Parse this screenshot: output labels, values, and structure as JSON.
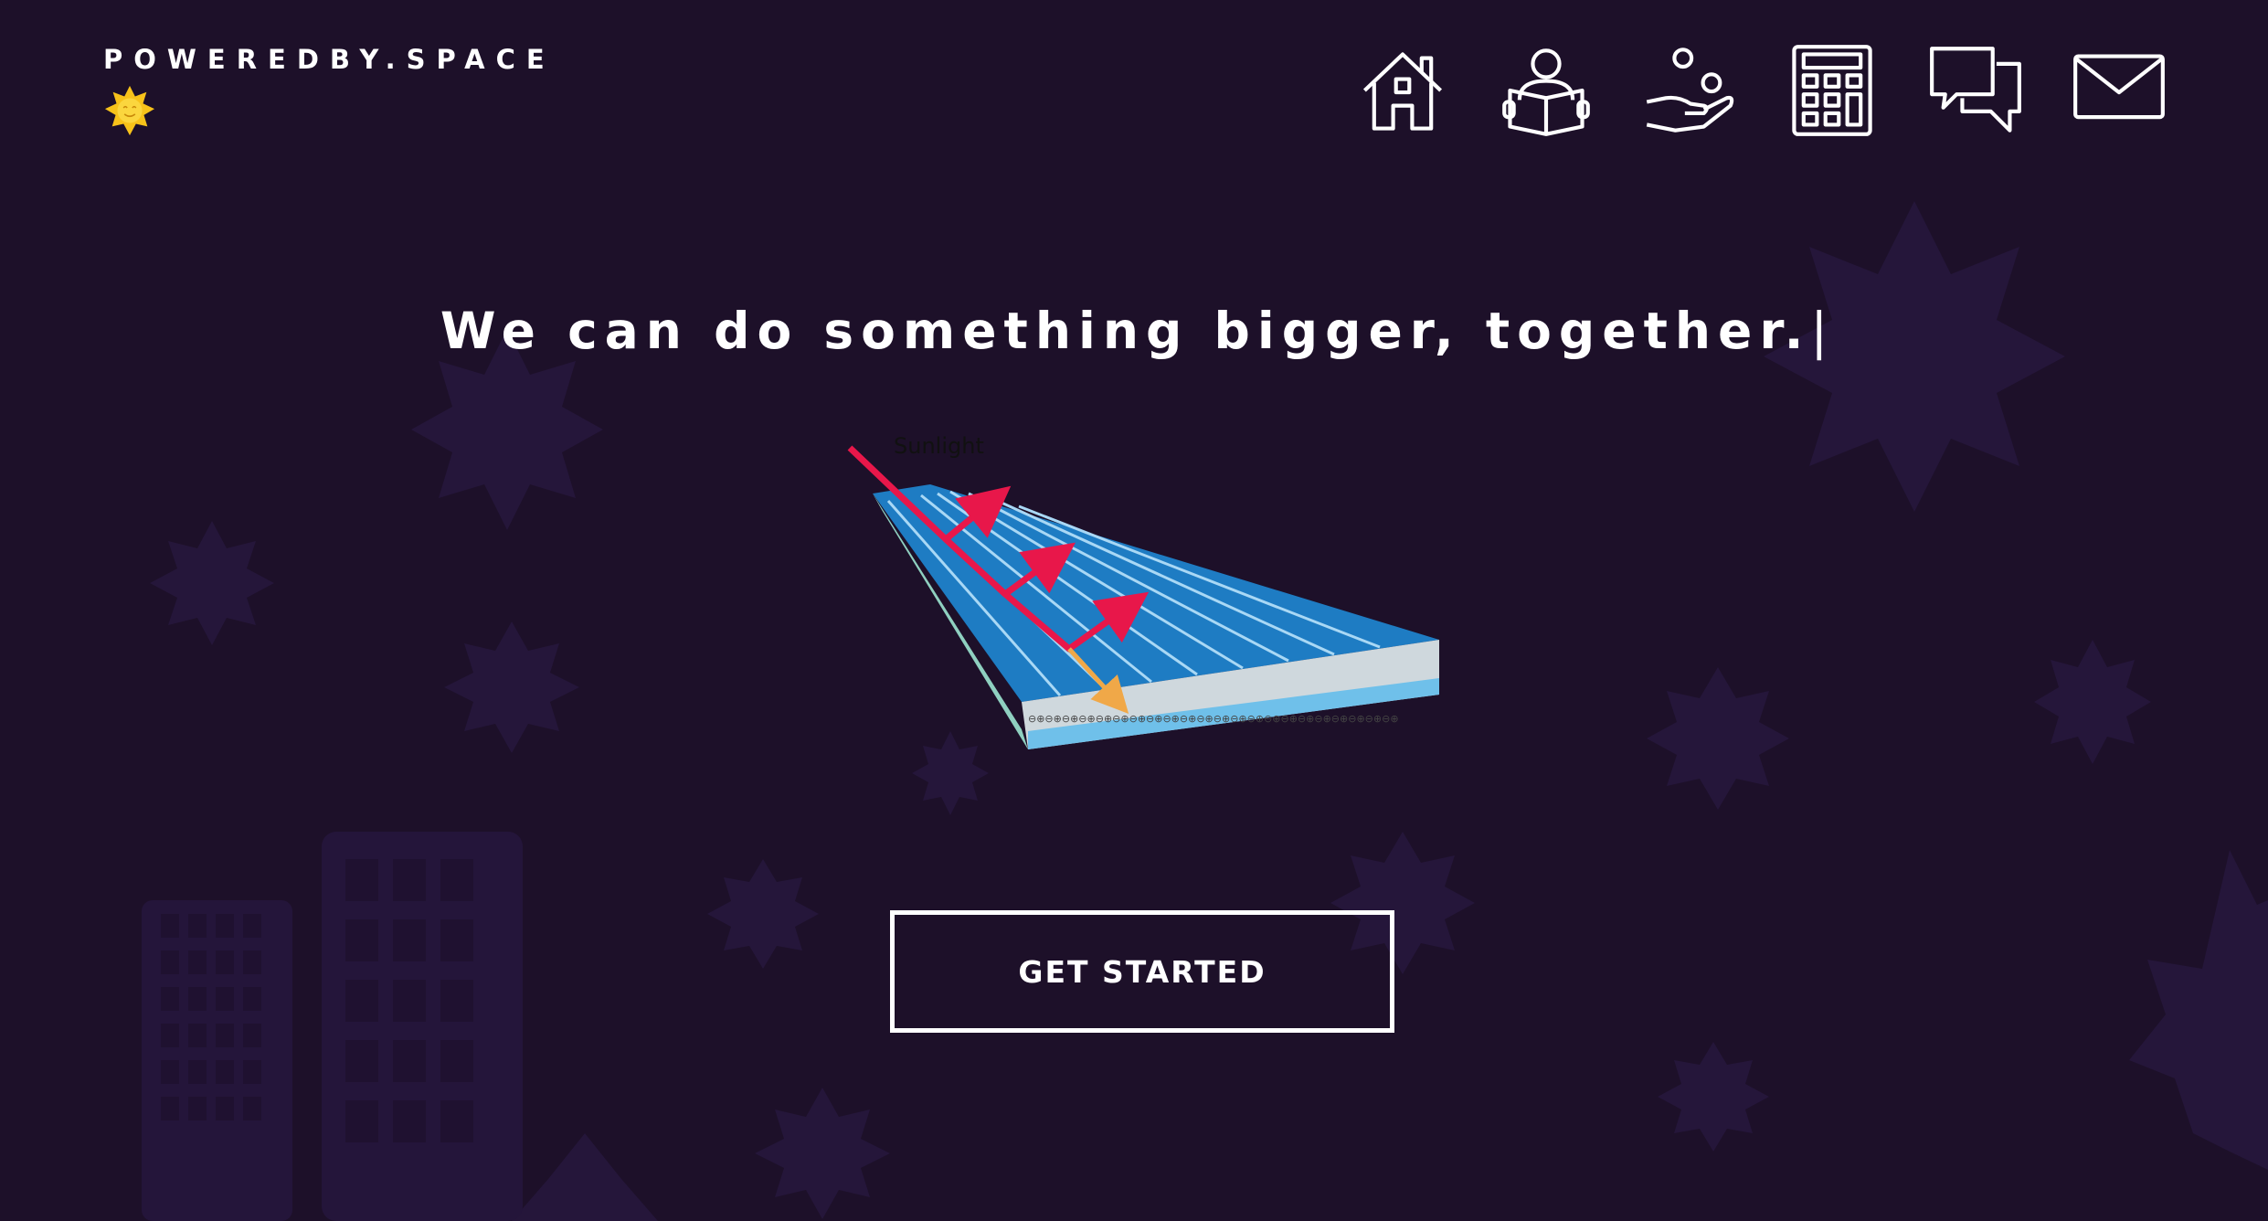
{
  "brand": {
    "name": "POWEREDBY.SPACE",
    "logo_icon": "sun-icon"
  },
  "nav": {
    "items": [
      {
        "icon": "home-icon"
      },
      {
        "icon": "reader-icon"
      },
      {
        "icon": "hand-offer-icon"
      },
      {
        "icon": "calculator-icon"
      },
      {
        "icon": "chat-bubbles-icon"
      },
      {
        "icon": "mail-icon"
      }
    ]
  },
  "hero": {
    "headline": "We can do something bigger, together.",
    "caret": "|",
    "illustration": {
      "label": "Sunlight"
    },
    "cta_label": "GET STARTED"
  },
  "colors": {
    "background": "#1d1029",
    "decor": "#261639",
    "panel_blue": "#1f7fc6",
    "arrow_red": "#e8174a",
    "arrow_orange": "#f0a848",
    "text": "#ffffff"
  }
}
